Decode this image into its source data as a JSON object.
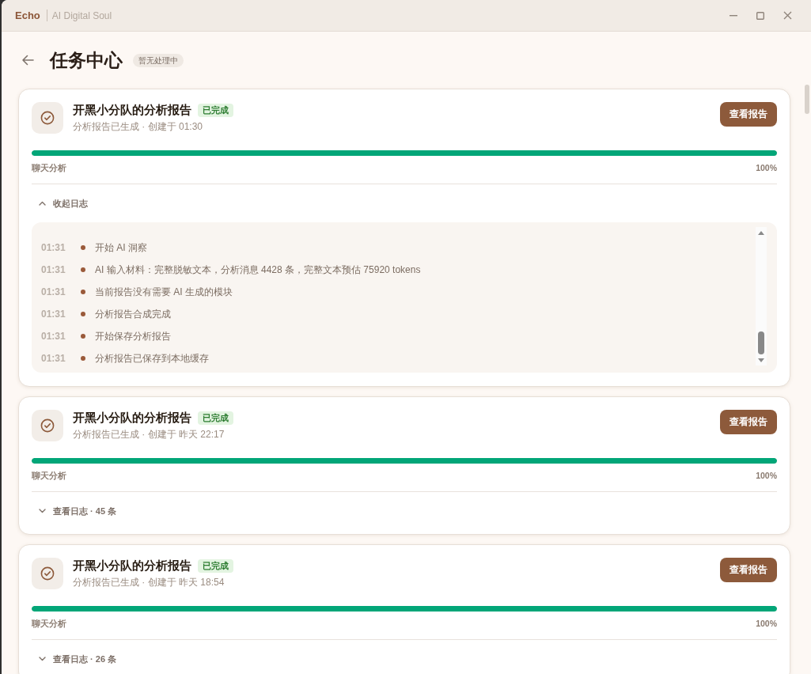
{
  "window": {
    "app_name": "Echo",
    "subtitle": "AI Digital Soul"
  },
  "header": {
    "title": "任务中心",
    "status_badge": "暂无处理中"
  },
  "tasks": [
    {
      "title": "开黑小分队的分析报告",
      "status": {
        "label": "已完成",
        "kind": "done"
      },
      "subtitle": "分析报告已生成 · 创建于 01:30",
      "button": "查看报告",
      "progress": {
        "label": "聊天分析",
        "level": 1,
        "reading": "100%"
      },
      "log_toggle": {
        "label": "收起日志",
        "expanded": true
      },
      "log": [
        {
          "time": "01:31",
          "message": "开始 AI 洞察"
        },
        {
          "time": "01:31",
          "message": "AI 输入材料：完整脱敏文本，分析消息 4428 条，完整文本预估 75920 tokens"
        },
        {
          "time": "01:31",
          "message": "当前报告没有需要 AI 生成的模块"
        },
        {
          "time": "01:31",
          "message": "分析报告合成完成"
        },
        {
          "time": "01:31",
          "message": "开始保存分析报告"
        },
        {
          "time": "01:31",
          "message": "分析报告已保存到本地缓存"
        }
      ]
    },
    {
      "title": "开黑小分队的分析报告",
      "status": {
        "label": "已完成",
        "kind": "done"
      },
      "subtitle": "分析报告已生成 · 创建于 昨天 22:17",
      "button": "查看报告",
      "progress": {
        "label": "聊天分析",
        "level": 1,
        "reading": "100%"
      },
      "log_toggle": {
        "label": "查看日志 · 45 条",
        "expanded": false
      }
    },
    {
      "title": "开黑小分队的分析报告",
      "status": {
        "label": "已完成",
        "kind": "done"
      },
      "subtitle": "分析报告已生成 · 创建于 昨天 18:54",
      "button": "查看报告",
      "progress": {
        "label": "聊天分析",
        "level": 1,
        "reading": "100%"
      },
      "log_toggle": {
        "label": "查看日志 · 26 条",
        "expanded": false
      }
    }
  ]
}
